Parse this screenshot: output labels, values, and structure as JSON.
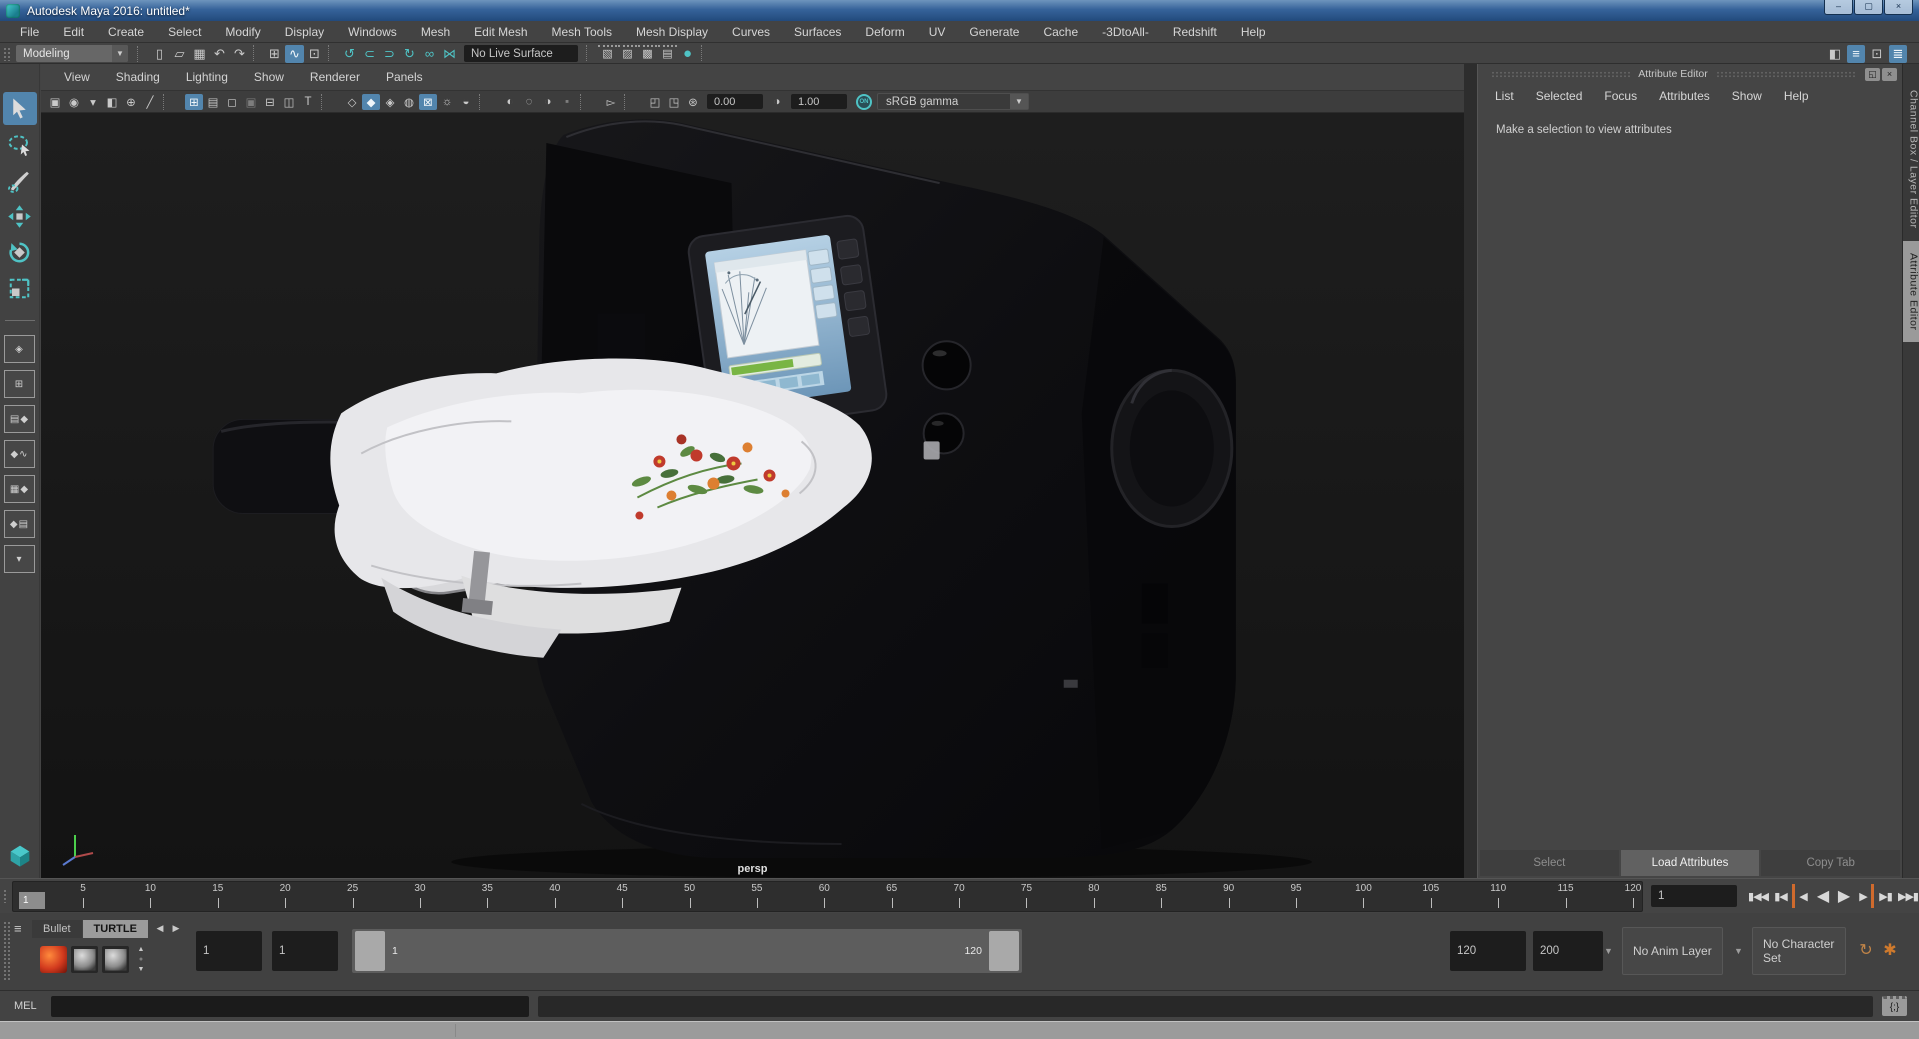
{
  "window": {
    "title": "Autodesk Maya 2016: untitled*",
    "buttons": [
      {
        "name": "minimize-button",
        "glyph": "–"
      },
      {
        "name": "maximize-button",
        "glyph": "▢"
      },
      {
        "name": "close-button",
        "glyph": "×"
      }
    ]
  },
  "menu_bar": {
    "items": [
      "File",
      "Edit",
      "Create",
      "Select",
      "Modify",
      "Display",
      "Windows",
      "Mesh",
      "Edit Mesh",
      "Mesh Tools",
      "Mesh Display",
      "Curves",
      "Surfaces",
      "Deform",
      "UV",
      "Generate",
      "Cache",
      "-3DtoAll-",
      "Redshift",
      "Help"
    ]
  },
  "status_line": {
    "menuset": "Modeling",
    "live_surface": "No Live Surface",
    "icons": [
      {
        "name": "new-scene-icon",
        "glyph": "▯"
      },
      {
        "name": "open-scene-icon",
        "glyph": "▱"
      },
      {
        "name": "save-scene-icon",
        "glyph": "▦"
      },
      {
        "name": "undo-icon",
        "glyph": "↶"
      },
      {
        "name": "redo-icon",
        "glyph": "↷"
      },
      {
        "name": "separator",
        "cls": "sep",
        "interactable": "false"
      },
      {
        "name": "snap-to-grids-icon",
        "glyph": "⊞"
      },
      {
        "name": "snap-to-curves-icon",
        "glyph": "∿",
        "active": true
      },
      {
        "name": "snap-to-points-icon",
        "glyph": "⊡"
      },
      {
        "name": "separator",
        "cls": "sep",
        "interactable": "false"
      },
      {
        "name": "make-live-icon",
        "glyph": "↺",
        "cls": "teal"
      },
      {
        "name": "input-connections-icon",
        "glyph": "⊂",
        "cls": "teal"
      },
      {
        "name": "output-connections-icon",
        "glyph": "⊃",
        "cls": "teal"
      },
      {
        "name": "history-icon",
        "glyph": "↻",
        "cls": "teal"
      },
      {
        "name": "construction-history-icon",
        "glyph": "∞",
        "cls": "teal"
      },
      {
        "name": "live-surface-link-icon",
        "glyph": "⋈",
        "cls": "teal"
      }
    ],
    "render_icons": [
      {
        "name": "separator",
        "cls": "sep",
        "interactable": "false"
      },
      {
        "name": "render-view-icon",
        "glyph": "▧",
        "cls": "rndr"
      },
      {
        "name": "render-current-frame-icon",
        "glyph": "▨",
        "cls": "rndr"
      },
      {
        "name": "ipr-render-icon",
        "glyph": "▩",
        "cls": "rndr"
      },
      {
        "name": "render-settings-icon",
        "glyph": "▤",
        "cls": "rndr"
      },
      {
        "name": "render-ball-icon",
        "glyph": "●",
        "cls": "ball"
      },
      {
        "name": "separator",
        "cls": "sep",
        "interactable": "false"
      }
    ],
    "right_icons": [
      {
        "name": "modeling-toolkit-toggle-icon",
        "glyph": "◧"
      },
      {
        "name": "attribute-editor-toggle-icon",
        "glyph": "≡",
        "active": true
      },
      {
        "name": "tool-settings-toggle-icon",
        "glyph": "⊡"
      },
      {
        "name": "channel-box-toggle-icon",
        "glyph": "≣",
        "active": true
      }
    ]
  },
  "panel_menu": {
    "items": [
      "View",
      "Shading",
      "Lighting",
      "Show",
      "Renderer",
      "Panels"
    ]
  },
  "viewport_toolbar": {
    "exposure": "0.00",
    "gamma": "1.00",
    "on_label": "ON",
    "gamma_mode": "sRGB gamma",
    "icons": [
      {
        "name": "select-camera-icon",
        "glyph": "▣"
      },
      {
        "name": "camera-attributes-icon",
        "glyph": "◉"
      },
      {
        "name": "bookmark-icon",
        "glyph": "▾"
      },
      {
        "name": "image-plane-icon",
        "glyph": "◧"
      },
      {
        "name": "two-d-pan-zoom-icon",
        "glyph": "⊕"
      },
      {
        "name": "grease-pencil-icon",
        "glyph": "╱"
      },
      {
        "name": "separator",
        "cls": "sep",
        "interactable": "false"
      },
      {
        "name": "grid-icon",
        "glyph": "⊞",
        "active": true
      },
      {
        "name": "film-gate-icon",
        "glyph": "▤"
      },
      {
        "name": "resolution-gate-icon",
        "glyph": "◻"
      },
      {
        "name": "gate-mask-icon",
        "glyph": "▣",
        "cls": "dim"
      },
      {
        "name": "field-chart-icon",
        "glyph": "⊟"
      },
      {
        "name": "safe-action-icon",
        "glyph": "◫"
      },
      {
        "name": "safe-title-icon",
        "glyph": "T"
      },
      {
        "name": "separator",
        "cls": "sep",
        "interactable": "false"
      },
      {
        "name": "wireframe-icon",
        "glyph": "◇"
      },
      {
        "name": "smooth-shade-icon",
        "glyph": "◆",
        "active": true
      },
      {
        "name": "wireframe-on-shaded-icon",
        "glyph": "◈"
      },
      {
        "name": "default-material-icon",
        "glyph": "◍"
      },
      {
        "name": "textured-icon",
        "glyph": "⊠",
        "active": true
      },
      {
        "name": "lighting-icon",
        "glyph": "☼"
      },
      {
        "name": "shadows-icon",
        "glyph": "◒"
      },
      {
        "name": "separator",
        "cls": "sep",
        "interactable": "false"
      },
      {
        "name": "occlusion-icon",
        "glyph": "◐"
      },
      {
        "name": "motion-blur-icon",
        "glyph": "◌"
      },
      {
        "name": "anti-alias-icon",
        "glyph": "◑"
      },
      {
        "name": "sequence-time-icon",
        "glyph": "▪",
        "cls": "dim"
      },
      {
        "name": "separator",
        "cls": "sep",
        "interactable": "false"
      },
      {
        "name": "isolate-select-icon",
        "glyph": "▻"
      },
      {
        "name": "separator",
        "cls": "sep",
        "interactable": "false"
      },
      {
        "name": "xray-icon",
        "glyph": "◰"
      },
      {
        "name": "xray-joints-icon",
        "glyph": "◳"
      }
    ]
  },
  "toolbox": {
    "tools": [
      {
        "name": "select-tool",
        "kind": "select",
        "active": true
      },
      {
        "name": "lasso-tool",
        "kind": "lasso"
      },
      {
        "name": "paint-select-tool",
        "kind": "paint"
      },
      {
        "name": "move-tool",
        "kind": "move"
      },
      {
        "name": "rotate-tool",
        "kind": "rotate"
      },
      {
        "name": "scale-tool",
        "kind": "scale"
      }
    ],
    "layouts": [
      {
        "name": "single-pane-layout-button",
        "glyph": "◈"
      },
      {
        "name": "four-pane-layout-button",
        "glyph": "⊞"
      },
      {
        "name": "outliner-persp-layout-button",
        "glyph": "▤◆"
      },
      {
        "name": "persp-graph-layout-button",
        "glyph": "◆∿"
      },
      {
        "name": "hypershade-persp-layout-button",
        "glyph": "▦◆"
      },
      {
        "name": "persp-outliner-graph-layout-button",
        "glyph": "◆▤"
      },
      {
        "name": "more-layouts-button",
        "glyph": "▾"
      }
    ]
  },
  "viewport": {
    "camera_label": "persp"
  },
  "attribute_editor": {
    "title": "Attribute Editor",
    "menu": [
      "List",
      "Selected",
      "Focus",
      "Attributes",
      "Show",
      "Help"
    ],
    "message": "Make a selection to view attributes",
    "window_icons": [
      {
        "name": "float-panel-icon",
        "glyph": "◱"
      },
      {
        "name": "close-panel-icon",
        "glyph": "×"
      }
    ],
    "buttons": [
      {
        "name": "select-button",
        "label": "Select"
      },
      {
        "name": "load-attributes-button",
        "label": "Load Attributes",
        "active": true
      },
      {
        "name": "copy-tab-button",
        "label": "Copy Tab"
      }
    ]
  },
  "right_tabs": [
    {
      "name": "tab-channel-box-layer-editor",
      "label": "Channel Box / Layer Editor"
    },
    {
      "name": "tab-attribute-editor",
      "label": "Attribute Editor",
      "active": true
    }
  ],
  "timeline": {
    "playhead_label": "1",
    "current_time": "1",
    "tick_frames": [
      5,
      10,
      15,
      20,
      25,
      30,
      35,
      40,
      45,
      50,
      55,
      60,
      65,
      70,
      75,
      80,
      85,
      90,
      95,
      100,
      105,
      110,
      115,
      120
    ],
    "playback": [
      {
        "name": "go-to-start-button",
        "glyph": "▮◀◀"
      },
      {
        "name": "step-back-frame-button",
        "glyph": "▮◀"
      },
      {
        "name": "step-back-key-button",
        "glyph": "◀",
        "cls": "key-l"
      },
      {
        "name": "play-backwards-button",
        "glyph": "◀",
        "cls": "big"
      },
      {
        "name": "play-forwards-button",
        "glyph": "▶",
        "cls": "big"
      },
      {
        "name": "step-forward-key-button",
        "glyph": "▶",
        "cls": "key-r"
      },
      {
        "name": "step-forward-frame-button",
        "glyph": "▶▮"
      },
      {
        "name": "go-to-end-button",
        "glyph": "▶▶▮"
      }
    ]
  },
  "range_slider": {
    "anim_start": "1",
    "playback_start": "1",
    "range_start_label": "1",
    "range_end_label": "120",
    "playback_end": "120",
    "anim_end": "200",
    "anim_layer": "No Anim Layer",
    "character_set": "No Character Set",
    "anim_pref_glyph": "↻",
    "char_set_glyph": "✱"
  },
  "shelf": {
    "menu_glyph": "≡",
    "tabs": [
      {
        "name": "shelf-tab-bullet",
        "label": "Bullet"
      },
      {
        "name": "shelf-tab-turtle",
        "label": "TURTLE",
        "active": true
      }
    ],
    "tab_arrows": [
      {
        "name": "shelf-prev-tab-icon",
        "glyph": "◀"
      },
      {
        "name": "shelf-next-tab-icon",
        "glyph": "▶"
      }
    ],
    "items": [
      {
        "name": "shelf-item-bullet-solver",
        "cls": "swatch-red"
      },
      {
        "name": "shelf-item-material-sphere-1",
        "cls": "swatch-sphere"
      },
      {
        "name": "shelf-item-material-sphere-2",
        "cls": "swatch-sphere"
      }
    ],
    "scroll": [
      {
        "name": "shelf-scroll-up-icon",
        "glyph": "▲"
      },
      {
        "name": "shelf-row-dot-icon",
        "glyph": "●",
        "cls": "dim",
        "interactable": "false"
      },
      {
        "name": "shelf-scroll-down-icon",
        "glyph": "▼"
      }
    ]
  },
  "command_line": {
    "label": "MEL",
    "script_editor_glyph": "{;}"
  },
  "colors": {
    "accent_blue": "#5285ad",
    "accent_teal": "#4fc3c5",
    "key_orange": "#cf6a2d"
  }
}
